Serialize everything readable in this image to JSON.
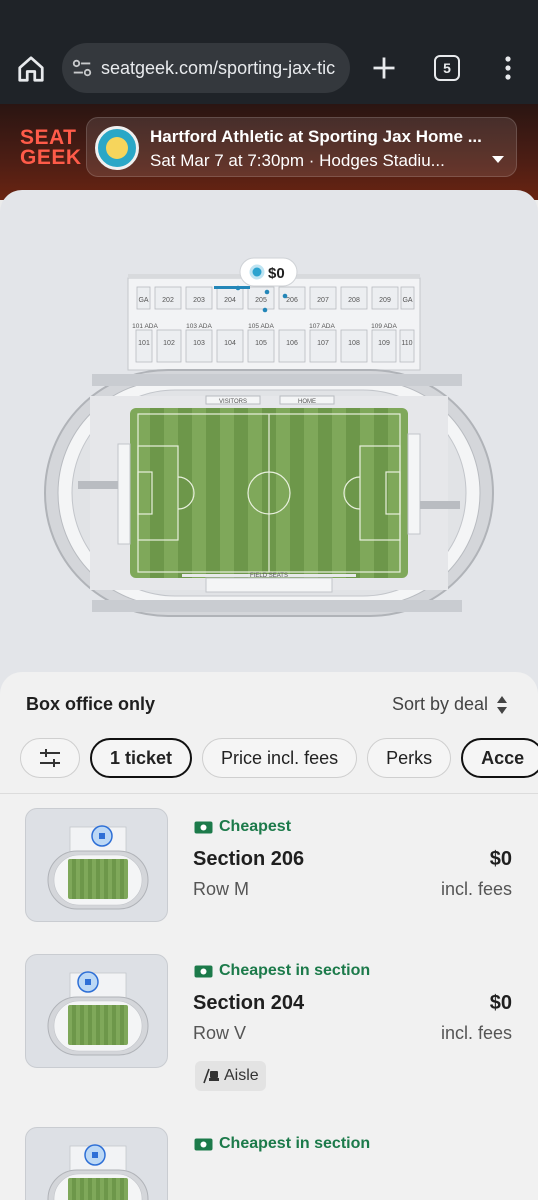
{
  "browser": {
    "url": "seatgeek.com/sporting-jax-tic",
    "tab_count": "5"
  },
  "header": {
    "logo_line1": "SEAT",
    "logo_line2": "GEEK",
    "event_title": "Hartford Athletic at Sporting Jax Home ...",
    "event_subtitle": "Sat Mar 7 at 7:30pm · Hodges Stadiu..."
  },
  "map": {
    "price_pin": "$0",
    "upper_sections": [
      "GA",
      "202",
      "203",
      "204",
      "205",
      "206",
      "207",
      "208",
      "209",
      "GA"
    ],
    "lower_sections": [
      "101",
      "102",
      "103",
      "104",
      "105",
      "106",
      "107",
      "108",
      "109",
      "110"
    ],
    "ada_labels": [
      "101 ADA",
      "103 ADA",
      "105 ADA",
      "107 ADA",
      "109 ADA"
    ],
    "visitors_label": "VISITORS",
    "home_label": "HOME",
    "field_seats_label": "FIELD SEATS"
  },
  "sheet": {
    "box_office": "Box office only",
    "sort_label": "Sort by deal",
    "filters": [
      "1 ticket",
      "Price incl. fees",
      "Perks",
      "Acce"
    ]
  },
  "listings": [
    {
      "tag": "Cheapest",
      "section": "Section 206",
      "row": "Row M",
      "price": "$0",
      "fees": "incl. fees"
    },
    {
      "tag": "Cheapest in section",
      "section": "Section 204",
      "row": "Row V",
      "price": "$0",
      "fees": "incl. fees",
      "perk": "Aisle"
    },
    {
      "tag": "Cheapest in section"
    }
  ],
  "colors": {
    "brand": "#ff5b49",
    "deal_green": "#1c7a4a",
    "pitch": "#7fa85a"
  }
}
